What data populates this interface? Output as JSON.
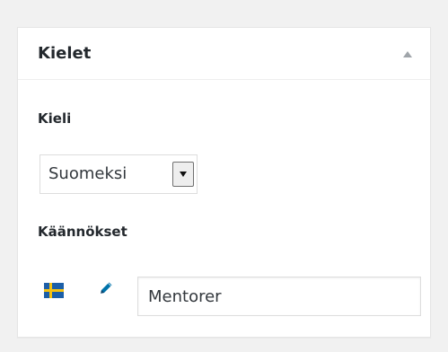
{
  "metabox": {
    "title": "Kielet",
    "toggle_icon": "triangle-up-icon"
  },
  "language": {
    "label": "Kieli",
    "selected": "Suomeksi",
    "dropdown_icon": "chevron-down-icon"
  },
  "translations": {
    "label": "Käännökset",
    "items": [
      {
        "flag_icon": "sweden-flag-icon",
        "edit_icon": "pencil-icon",
        "value": "Mentorer"
      }
    ]
  },
  "colors": {
    "background": "#f1f1f1",
    "panel": "#ffffff",
    "border": "#e5e5e5",
    "text": "#23282d",
    "pencil": "#0073aa"
  }
}
